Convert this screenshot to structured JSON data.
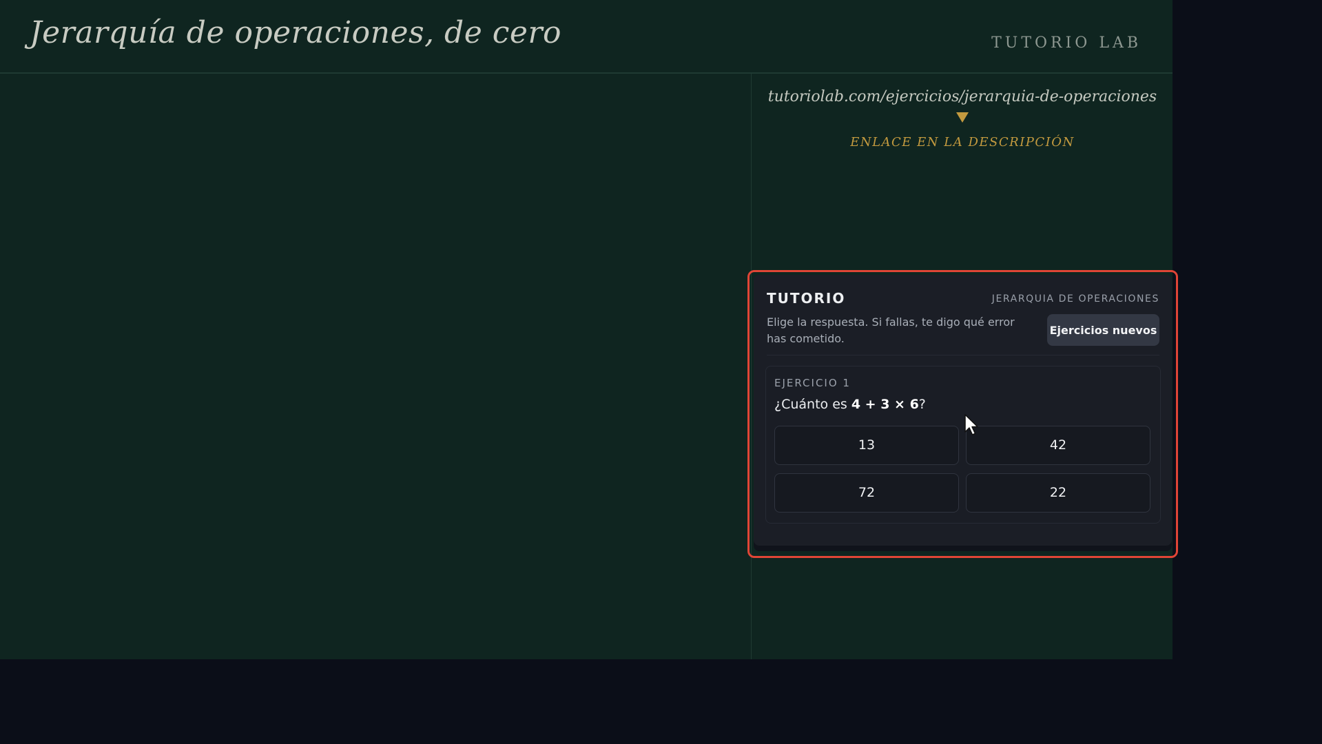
{
  "header": {
    "title": "Jerarquía de operaciones, de cero",
    "brand": "TUTORIO LAB"
  },
  "link_panel": {
    "url": "tutoriolab.com/ejercicios/jerarquia-de-operaciones",
    "arrow_icon": "arrow-down-icon",
    "note": "ENLACE EN LA DESCRIPCIÓN"
  },
  "tutor": {
    "title": "TUTORIO",
    "topic": "JERARQUIA DE OPERACIONES",
    "instructions": "Elige la respuesta. Si fallas, te digo qué error has cometido.",
    "new_exercises_label": "Ejercicios nuevos",
    "exercise": {
      "label": "EJERCICIO 1",
      "question_prefix": "¿Cuánto es ",
      "expression": "4 + 3 × 6",
      "question_suffix": "?",
      "answers": [
        "13",
        "42",
        "72",
        "22"
      ]
    }
  },
  "colors": {
    "stage_bg": "#0f2520",
    "outer_bg": "#0b0e18",
    "accent_gold": "#c39a3f",
    "highlight_red": "#e04536",
    "card_bg": "#1b1e26"
  },
  "cursor_icon": "mouse-pointer-icon"
}
